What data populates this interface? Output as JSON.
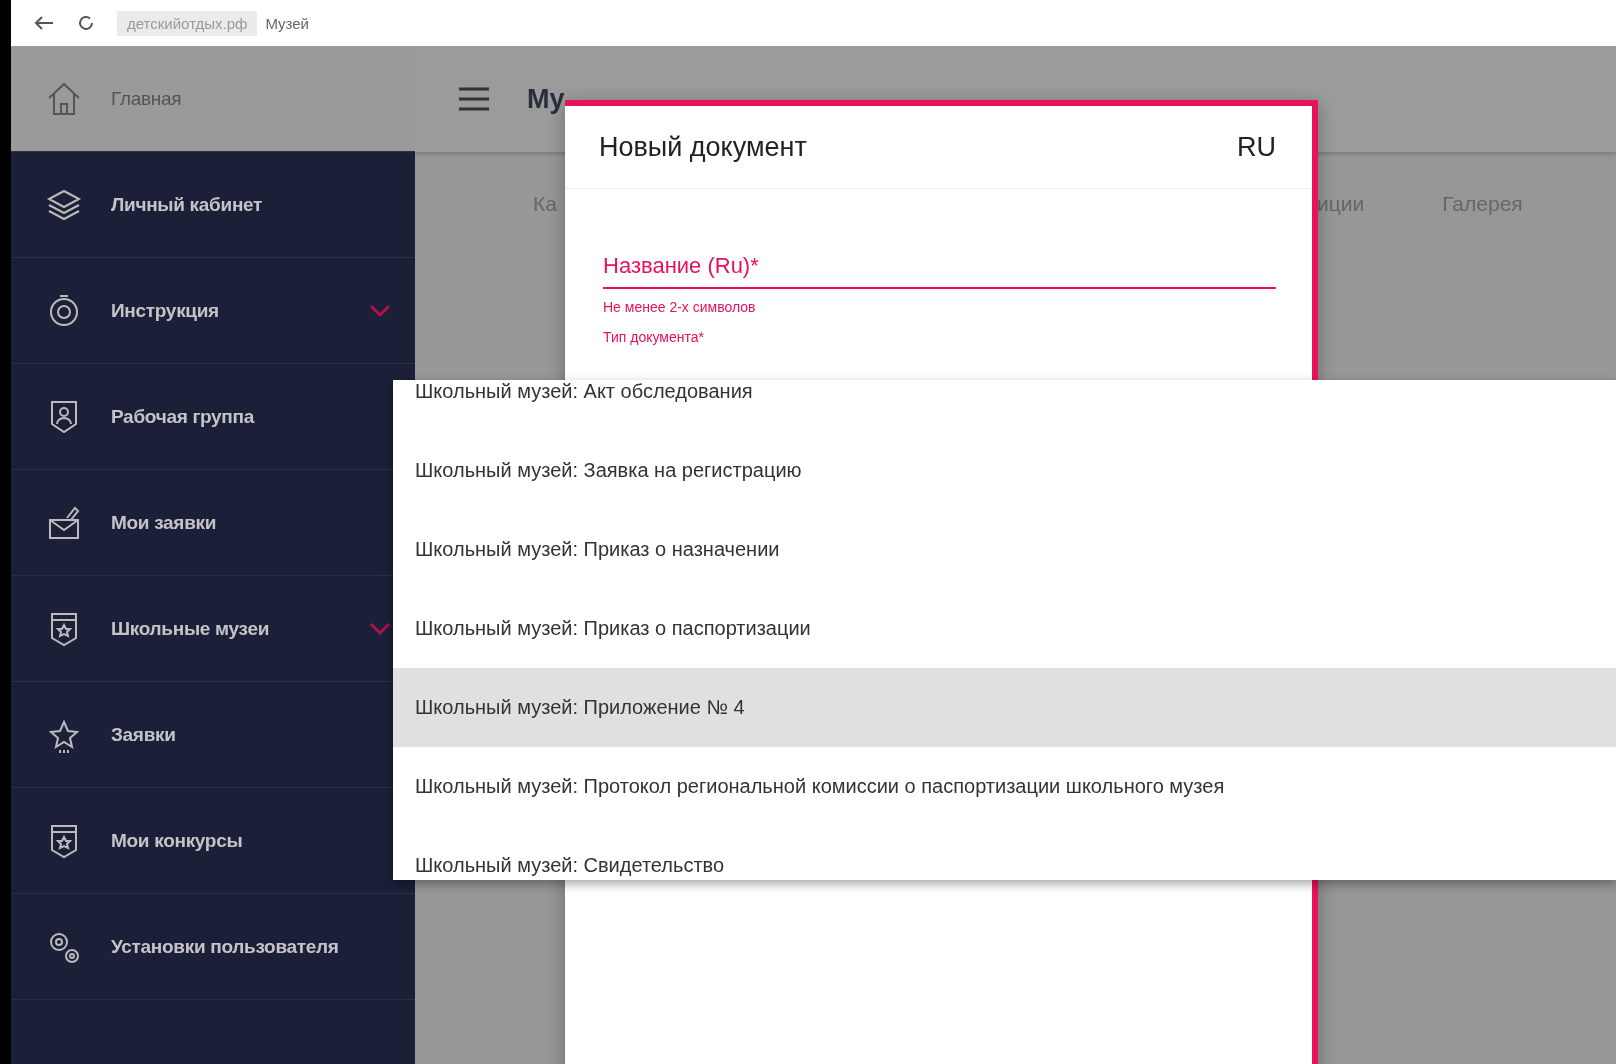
{
  "browser": {
    "address": "детскийотдых.рф",
    "page_title": "Музей"
  },
  "sidebar": {
    "items": [
      {
        "label": "Главная",
        "has_submenu": false,
        "selected": true
      },
      {
        "label": "Личный кабинет",
        "has_submenu": false,
        "selected": false
      },
      {
        "label": "Инструкция",
        "has_submenu": true,
        "selected": false
      },
      {
        "label": "Рабочая группа",
        "has_submenu": false,
        "selected": false
      },
      {
        "label": "Мои заявки",
        "has_submenu": false,
        "selected": false
      },
      {
        "label": "Школьные музеи",
        "has_submenu": true,
        "selected": false
      },
      {
        "label": "Заявки",
        "has_submenu": false,
        "selected": false
      },
      {
        "label": "Мои конкурсы",
        "has_submenu": false,
        "selected": false
      },
      {
        "label": "Установки пользователя",
        "has_submenu": false,
        "selected": false
      }
    ]
  },
  "header": {
    "title": "Му"
  },
  "tabs": [
    {
      "label": "Ка"
    },
    {
      "label": "иции"
    },
    {
      "label": "Галерея"
    }
  ],
  "dialog": {
    "title": "Новый документ",
    "language": "RU",
    "field": {
      "label": "Название (Ru)*",
      "hint": "Не менее 2-х символов"
    },
    "type_label": "Тип документа*"
  },
  "dropdown": {
    "options": [
      {
        "label": "Школьный музей: Акт обследования",
        "selected": false
      },
      {
        "label": "Школьный музей: Заявка на регистрацию",
        "selected": false
      },
      {
        "label": "Школьный музей: Приказ о назначении",
        "selected": false
      },
      {
        "label": "Школьный музей: Приказ о паспортизации",
        "selected": false
      },
      {
        "label": "Школьный музей: Приложение № 4",
        "selected": true
      },
      {
        "label": "Школьный музей: Протокол региональной комиссии о паспортизации школьного музея",
        "selected": false
      },
      {
        "label": "Школьный музей: Свидетельство",
        "selected": false
      }
    ]
  }
}
